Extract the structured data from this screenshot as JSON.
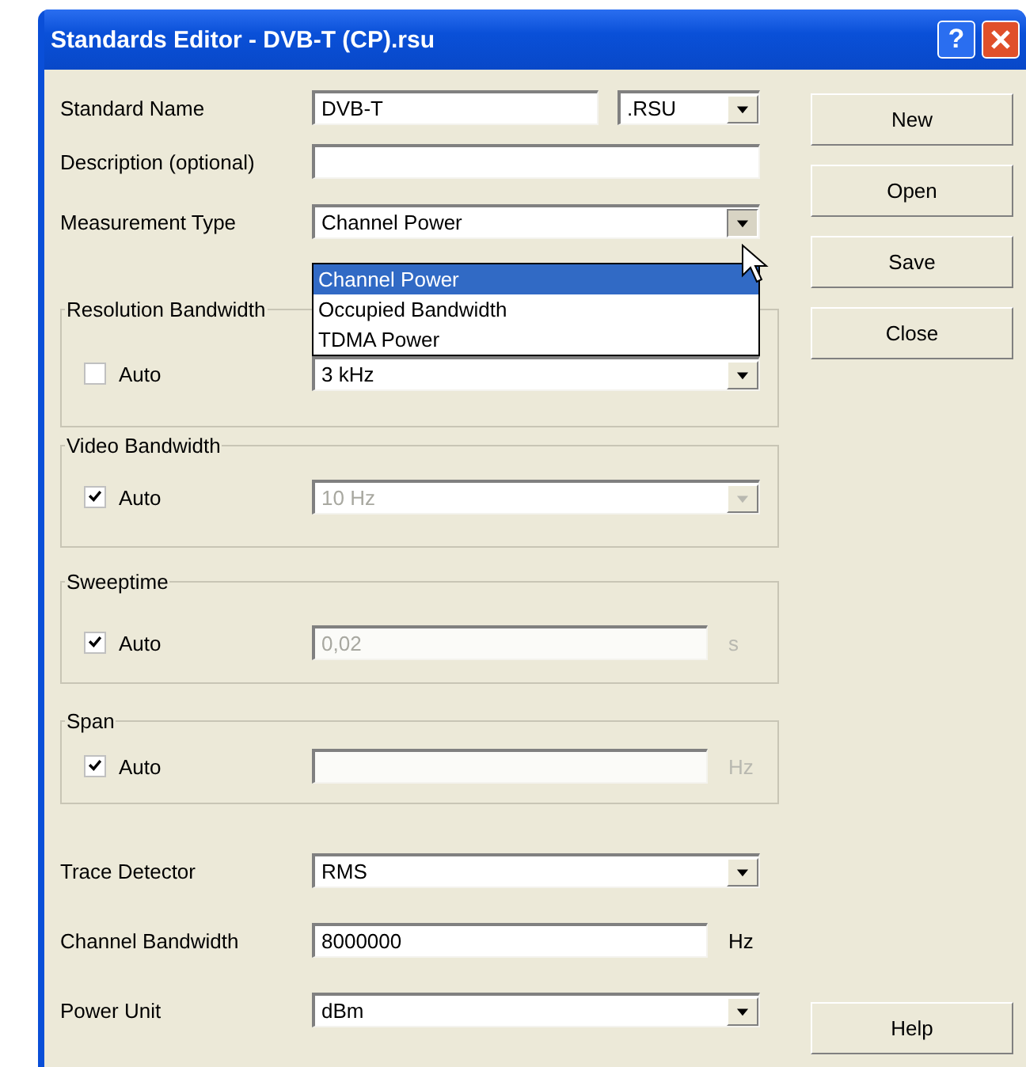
{
  "window": {
    "title": "Standards Editor - DVB-T (CP).rsu",
    "help_glyph": "?"
  },
  "standard_name": {
    "label": "Standard Name",
    "value": "DVB-T",
    "extension": ".RSU"
  },
  "description": {
    "label": "Description (optional)"
  },
  "measurement_type": {
    "label": "Measurement Type",
    "value": "Channel Power",
    "expanded": true,
    "options": [
      {
        "label": "Channel Power",
        "selected": true
      },
      {
        "label": "Occupied Bandwidth",
        "selected": false
      },
      {
        "label": "TDMA Power",
        "selected": false
      }
    ]
  },
  "groups": [
    {
      "title": "Resolution Bandwidth",
      "auto_label": "Auto",
      "checked": false,
      "kind": "select",
      "value": "3 kHz",
      "disabled": false
    },
    {
      "title": "Video Bandwidth",
      "auto_label": "Auto",
      "checked": true,
      "kind": "select",
      "value": "10 Hz",
      "disabled": true
    },
    {
      "title": "Sweeptime",
      "auto_label": "Auto",
      "checked": true,
      "kind": "input",
      "value": "0,02",
      "unit": "s",
      "disabled": true
    },
    {
      "title": "Span",
      "auto_label": "Auto",
      "checked": true,
      "kind": "input",
      "unit": "Hz",
      "disabled": true
    }
  ],
  "trace_detector": {
    "label": "Trace Detector",
    "value": "RMS"
  },
  "channel_bandwidth": {
    "label": "Channel Bandwidth",
    "value": "8000000",
    "unit": "Hz"
  },
  "power_unit": {
    "label": "Power Unit",
    "value": "dBm"
  },
  "buttons": [
    "New",
    "Open",
    "Save",
    "Close"
  ],
  "help_button": "Help"
}
